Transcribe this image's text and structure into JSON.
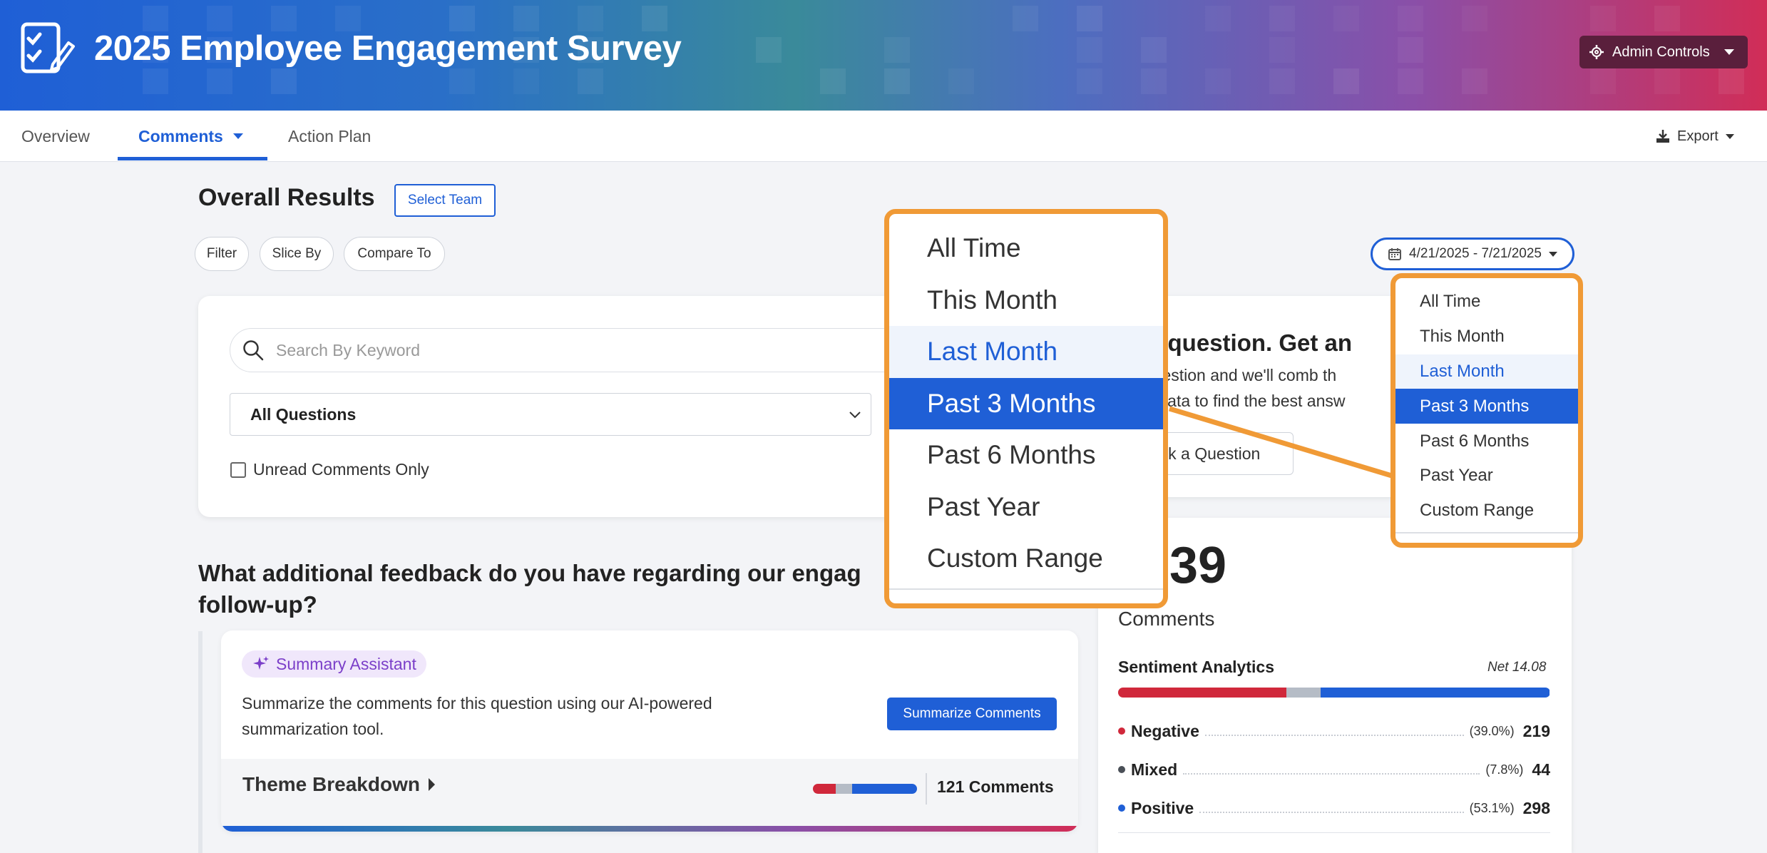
{
  "header": {
    "title": "2025 Employee Engagement Survey",
    "logo_icon": "survey-checklist-icon",
    "admin_label": "Admin Controls",
    "colors": {
      "start": "#1f5fd6",
      "end": "#d12d57",
      "admin_bg": "#5a1f3c"
    }
  },
  "tabs": {
    "overview": "Overview",
    "comments": "Comments",
    "action_plan": "Action Plan",
    "export": "Export"
  },
  "toolbar": {
    "overall_title": "Overall Results",
    "select_team": "Select Team",
    "filter": "Filter",
    "slice_by": "Slice By",
    "compare_to": "Compare To",
    "date_range": "4/21/2025 - 7/21/2025"
  },
  "search": {
    "placeholder": "Search By Keyword",
    "question_select": "All Questions",
    "unread_only": "Unread Comments Only",
    "unread_checked": false
  },
  "ask": {
    "title": "a question. Get an",
    "desc_line1": "y question and we'll comb th",
    "desc_line2": "ent data to find the best answ",
    "button": "sk a Question"
  },
  "comments_summary": {
    "total_partial": "39",
    "label": "Comments",
    "sentiment_title": "Sentiment Analytics",
    "net": "Net 14.08",
    "rows": [
      {
        "label": "Negative",
        "pct": "(39.0%)",
        "count": "219",
        "color": "#d0283b",
        "share": 0.39
      },
      {
        "label": "Mixed",
        "pct": "(7.8%)",
        "count": "44",
        "color": "#b5bcc6",
        "share": 0.078
      },
      {
        "label": "Positive",
        "pct": "(53.1%)",
        "count": "298",
        "color": "#1f5fd6",
        "share": 0.531
      }
    ],
    "dot_colors": {
      "negative": "#d0283b",
      "mixed": "#4a4f57",
      "positive": "#1f5fd6"
    }
  },
  "question": {
    "text_line1": "What additional feedback do you have regarding our engag",
    "text_line2": "follow-up?",
    "assistant_label": "Summary Assistant",
    "summary_line1": "Summarize the comments for this question using our AI-powered",
    "summary_line2": "summarization tool.",
    "summarize_button": "Summarize Comments",
    "theme_label": "Theme Breakdown",
    "theme_count": "121 Comments",
    "theme_mix": [
      {
        "color": "#d0283b",
        "share": 0.22
      },
      {
        "color": "#b5bcc6",
        "share": 0.16
      },
      {
        "color": "#1f5fd6",
        "share": 0.62
      }
    ]
  },
  "date_menu": {
    "items": [
      "All Time",
      "This Month",
      "Last Month",
      "Past 3 Months",
      "Past 6 Months",
      "Past Year",
      "Custom Range"
    ],
    "hovered": "Last Month",
    "selected": "Past 3 Months",
    "highlight_color": "#f09a36"
  }
}
